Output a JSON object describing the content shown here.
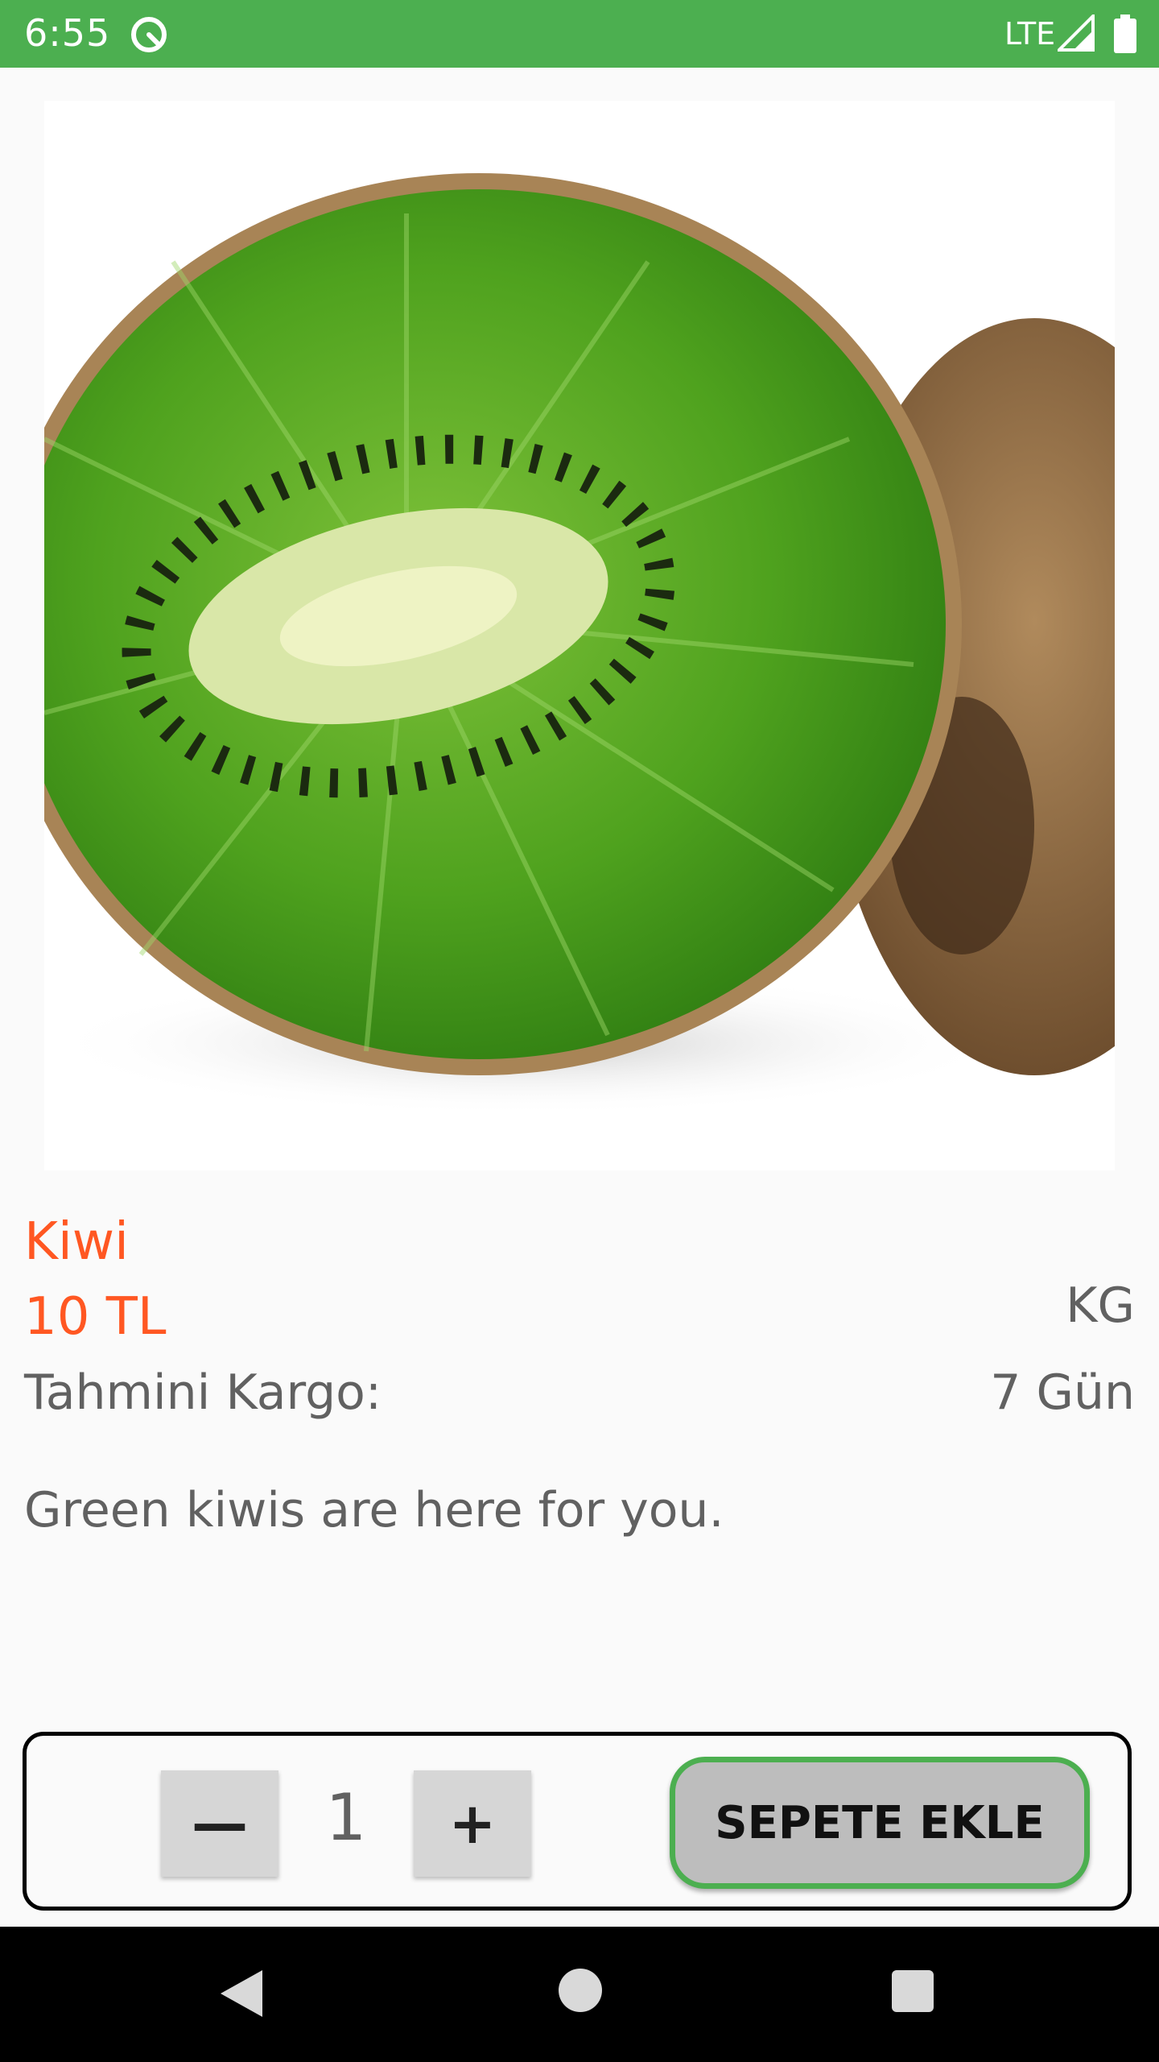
{
  "status_bar": {
    "time": "6:55",
    "network": "LTE",
    "background_color": "#4caf50"
  },
  "product": {
    "image_icon": "kiwi-photo",
    "name": "Kiwi",
    "price": "10 TL",
    "unit": "KG",
    "cargo_label": "Tahmini Kargo:",
    "cargo_value": "7 Gün",
    "description": "Green kiwis are here for you.",
    "accent_color": "#ff5722"
  },
  "cart": {
    "decrement_label": "—",
    "quantity": "1",
    "increment_label": "+",
    "add_button_label": "SEPETE EKLE",
    "add_button_border_color": "#4caf50"
  },
  "nav_bar": {
    "back_icon": "back-triangle-icon",
    "home_icon": "home-circle-icon",
    "recent_icon": "recent-square-icon"
  }
}
